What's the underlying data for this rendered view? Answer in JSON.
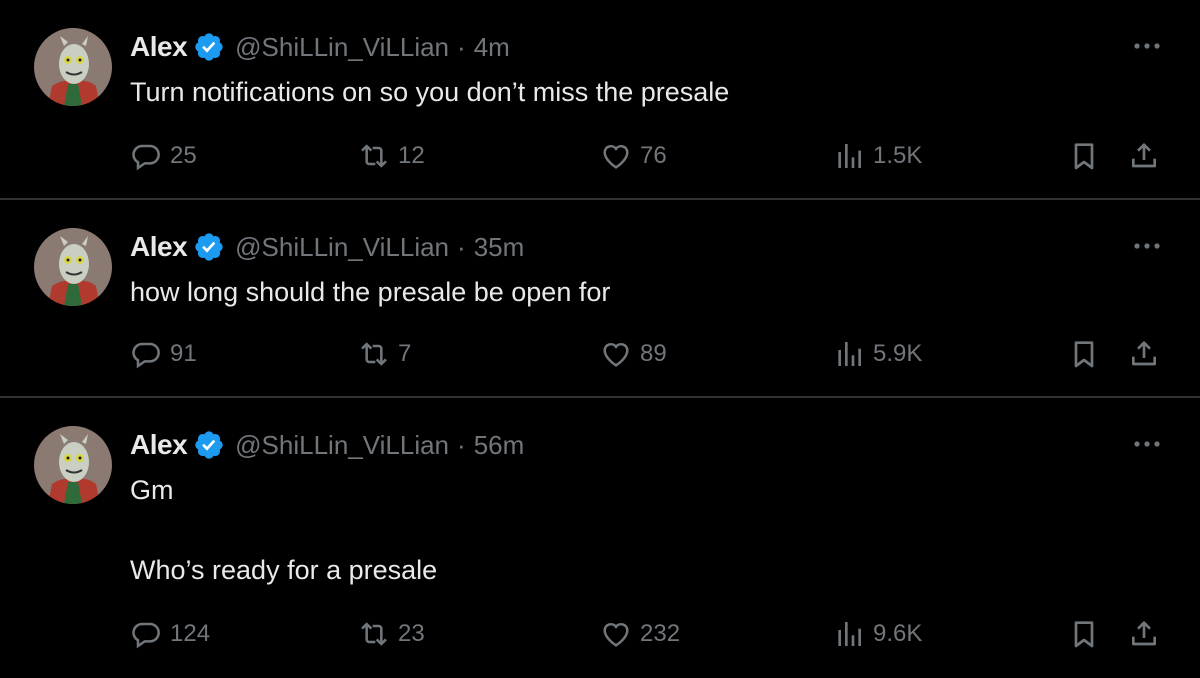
{
  "colors": {
    "background": "#000000",
    "divider": "#2f3336",
    "primary_text": "#e7e9ea",
    "secondary_text": "#71767b",
    "verified_badge": "#1d9bf0"
  },
  "icons": {
    "verified": "verified-badge-icon",
    "more": "more-horizontal-icon",
    "reply": "reply-bubble-icon",
    "retweet": "retweet-icon",
    "like": "heart-icon",
    "views": "views-bar-chart-icon",
    "bookmark": "bookmark-icon",
    "share": "share-upload-icon"
  },
  "tweets": [
    {
      "name": "Alex",
      "handle": "@ShiLLin_ViLLian",
      "separator": "·",
      "time": "4m",
      "text": "Turn notifications on so you don’t miss the presale",
      "replies": "25",
      "retweets": "12",
      "likes": "76",
      "views": "1.5K"
    },
    {
      "name": "Alex",
      "handle": "@ShiLLin_ViLLian",
      "separator": "·",
      "time": "35m",
      "text": "how long should the presale be open for",
      "replies": "91",
      "retweets": "7",
      "likes": "89",
      "views": "5.9K"
    },
    {
      "name": "Alex",
      "handle": "@ShiLLin_ViLLian",
      "separator": "·",
      "time": "56m",
      "text": "Gm\n\nWho’s ready for a presale",
      "replies": "124",
      "retweets": "23",
      "likes": "232",
      "views": "9.6K"
    }
  ]
}
